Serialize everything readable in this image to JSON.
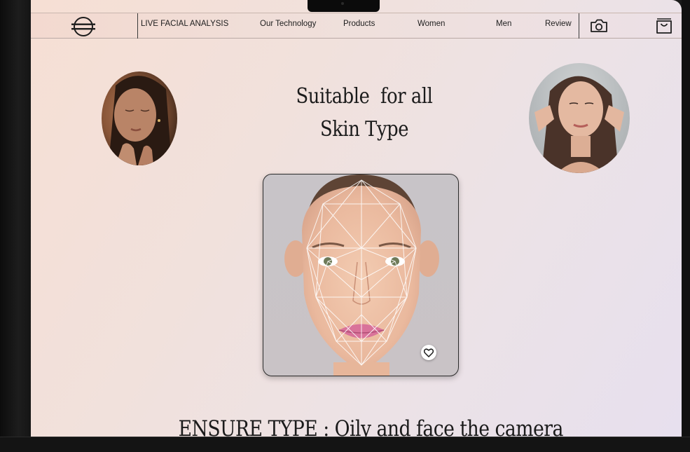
{
  "nav": {
    "items": [
      {
        "label": "LIVE FACIAL ANALYSIS"
      },
      {
        "label": "Our Technology"
      },
      {
        "label": "Products"
      },
      {
        "label": "Women"
      },
      {
        "label": "Men"
      },
      {
        "label": "Review"
      }
    ],
    "camera_icon": "camera-icon",
    "cart_icon": "shopping-bag-icon",
    "logo_icon": "brand-logo-icon"
  },
  "hero": {
    "headline_line1": "Suitable  for all",
    "headline_line2": "Skin Type"
  },
  "scan": {
    "favorite_icon": "heart-icon"
  },
  "instruction": {
    "text": "ENSURE TYPE : Oily and face the camera"
  },
  "colors": {
    "background_start": "#f6dfd4",
    "background_end": "#e7e0ee",
    "text": "#1b1b1b",
    "mesh_lines": "#ffffff"
  }
}
